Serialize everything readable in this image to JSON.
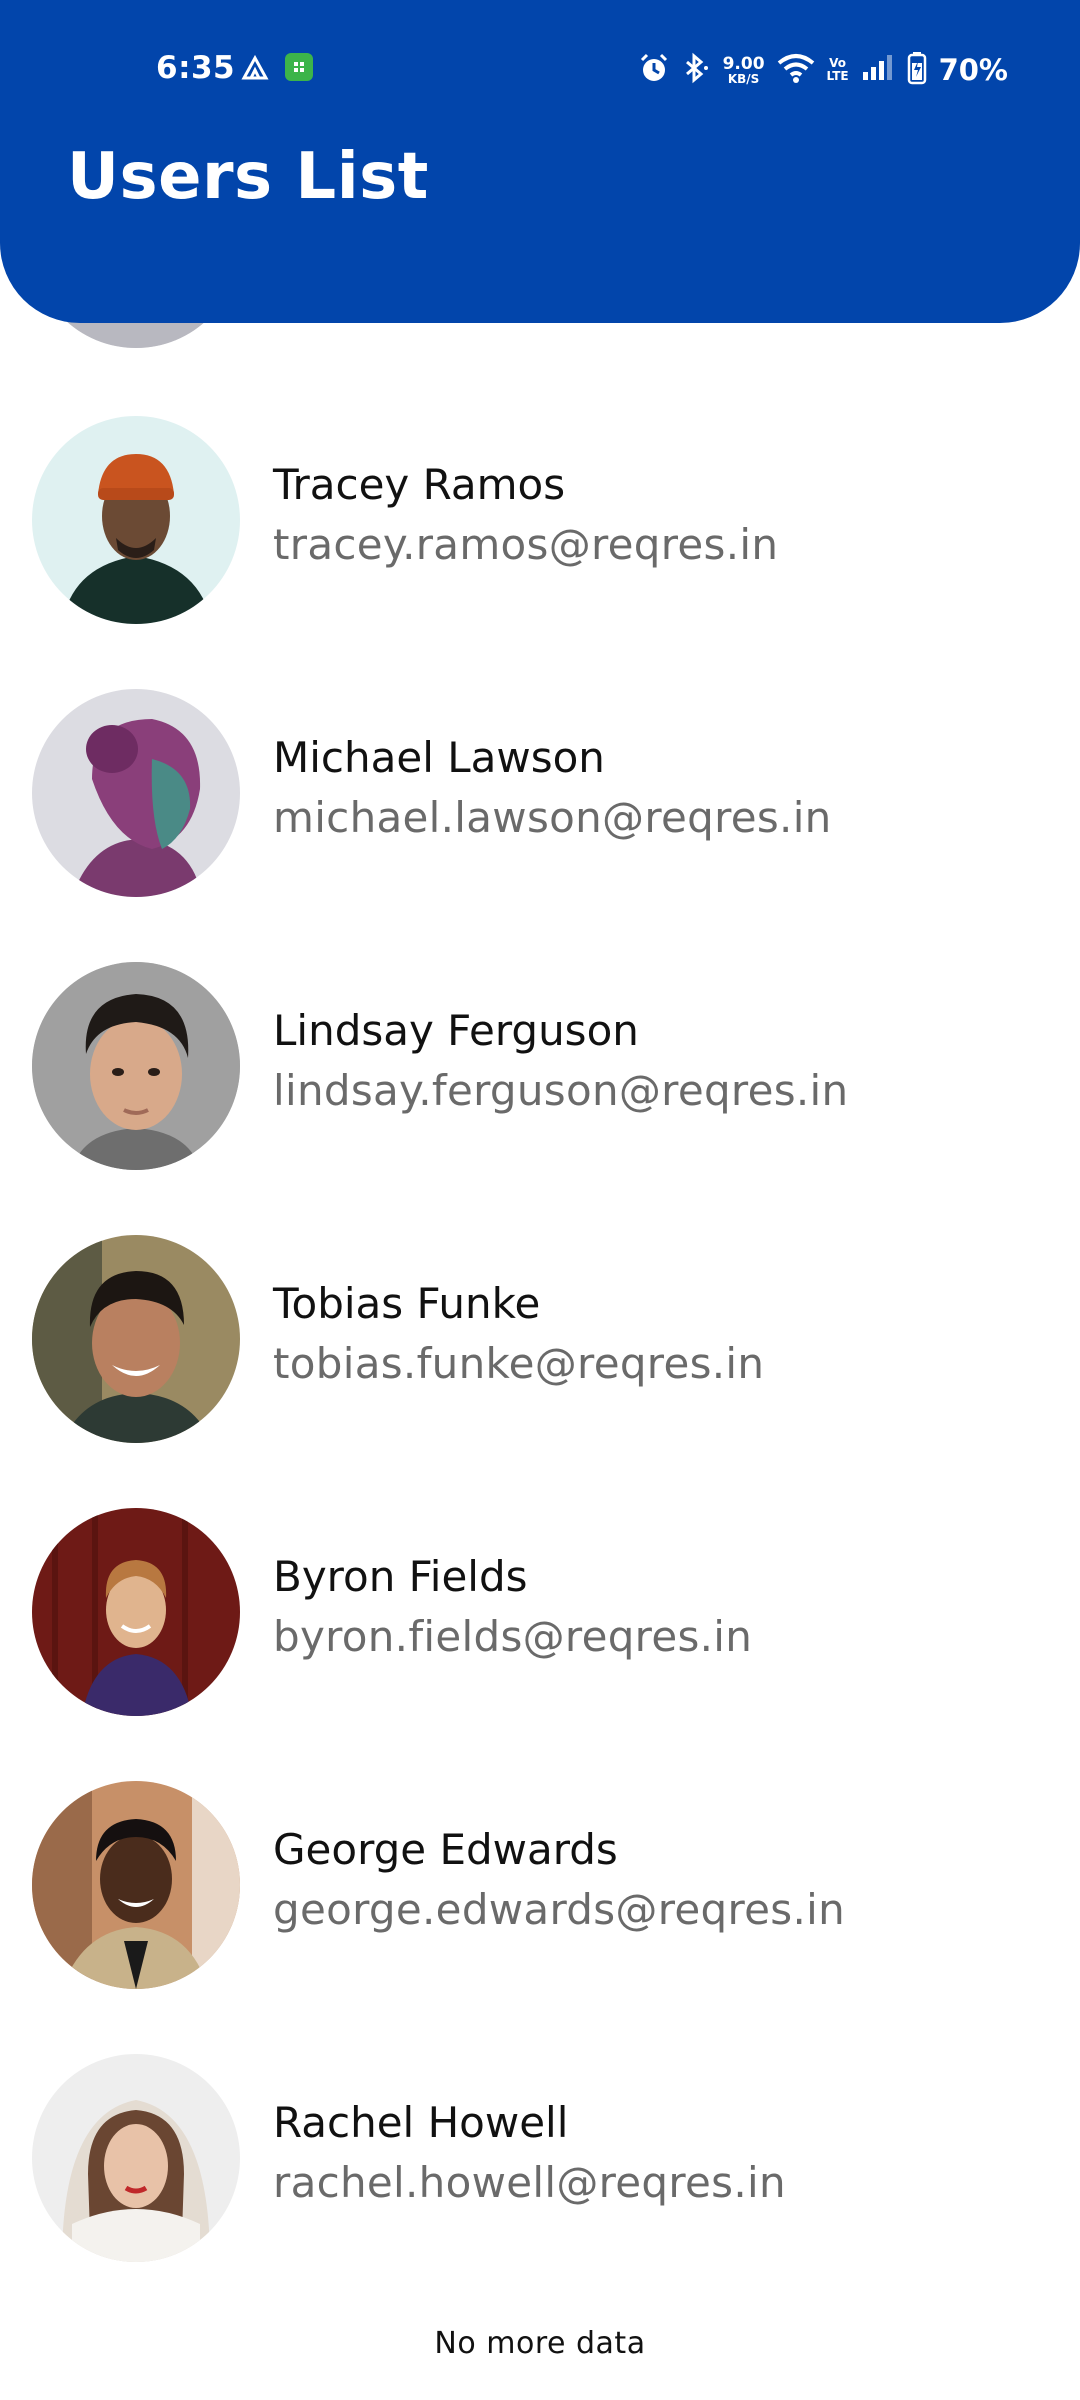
{
  "status_bar": {
    "time": "6:35",
    "net_speed_value": "9.00",
    "net_speed_unit": "KB/S",
    "volte_top": "Vo",
    "volte_bottom": "LTE",
    "battery": "70%",
    "icons": [
      "tent-icon",
      "grid-app-icon",
      "alarm-icon",
      "bluetooth-icon",
      "wifi-icon",
      "signal-icon",
      "battery-charging-icon"
    ]
  },
  "header": {
    "title": "Users List",
    "color": "#0245AB"
  },
  "users": [
    {
      "name": "Tracey Ramos",
      "email": "tracey.ramos@reqres.in",
      "avatar": "man-orange-beanie-avatar"
    },
    {
      "name": "Michael Lawson",
      "email": "michael.lawson@reqres.in",
      "avatar": "woman-purple-profile-avatar"
    },
    {
      "name": "Lindsay Ferguson",
      "email": "lindsay.ferguson@reqres.in",
      "avatar": "young-man-portrait-avatar"
    },
    {
      "name": "Tobias Funke",
      "email": "tobias.funke@reqres.in",
      "avatar": "smiling-man-avatar"
    },
    {
      "name": "Byron Fields",
      "email": "byron.fields@reqres.in",
      "avatar": "man-red-wall-avatar"
    },
    {
      "name": "George Edwards",
      "email": "george.edwards@reqres.in",
      "avatar": "man-street-avatar"
    },
    {
      "name": "Rachel Howell",
      "email": "rachel.howell@reqres.in",
      "avatar": "woman-white-hood-avatar"
    }
  ],
  "footer": {
    "text": "No more data"
  }
}
